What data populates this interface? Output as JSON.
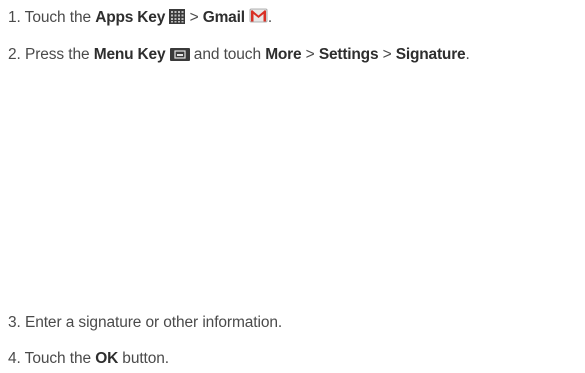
{
  "steps": [
    {
      "number": "1.",
      "parts": {
        "t1": "Touch the",
        "b1": "Apps Key",
        "sep1": ">",
        "b2": "Gmail",
        "end": "."
      },
      "icons": [
        "apps-grid-icon",
        "gmail-envelope-icon"
      ]
    },
    {
      "number": "2.",
      "parts": {
        "t1": "Press the",
        "b1": "Menu Key",
        "t2": "and touch",
        "b2": "More",
        "sep1": ">",
        "b3": "Settings",
        "sep2": ">",
        "b4": "Signature",
        "end": "."
      },
      "icons": [
        "menu-key-icon"
      ]
    },
    {
      "number": "3.",
      "parts": {
        "t1": "Enter a signature or other information."
      }
    },
    {
      "number": "4.",
      "parts": {
        "t1": "Touch the",
        "b1": "OK",
        "t2": "button."
      }
    }
  ],
  "colors": {
    "text": "#4a4a4a",
    "emphasis": "#2e2e2e",
    "icon_dark": "#3a3a3a",
    "gmail_red": "#d93025"
  }
}
